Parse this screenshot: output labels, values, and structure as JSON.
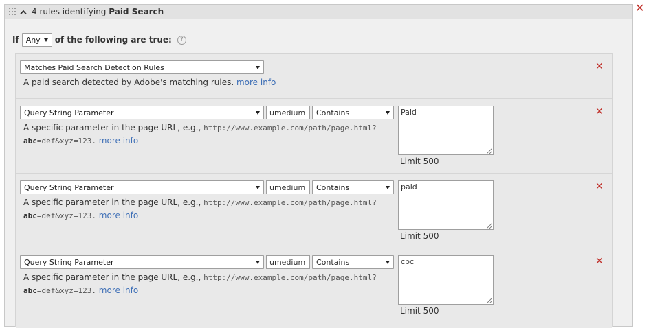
{
  "header": {
    "title_prefix": "4 rules identifying",
    "title_bold": "Paid Search"
  },
  "condition": {
    "if_label": "If",
    "match_value": "Any",
    "suffix": "of the following are true:",
    "help_glyph": "?"
  },
  "close_glyph": "✕",
  "rules": [
    {
      "type": "Matches Paid Search Detection Rules",
      "description": "A paid search detected by Adobe's matching rules.",
      "more_info": "more info"
    },
    {
      "type": "Query String Parameter",
      "param": "umedium",
      "operator": "Contains",
      "value": "Paid",
      "limit": "Limit 500",
      "desc_prefix": "A specific parameter in the page URL, e.g.,",
      "desc_url": "http://www.example.com/path/page.html?",
      "desc_param": "abc",
      "desc_rest": "=def&xyz=123.",
      "more_info": "more info"
    },
    {
      "type": "Query String Parameter",
      "param": "umedium",
      "operator": "Contains",
      "value": "paid",
      "limit": "Limit 500",
      "desc_prefix": "A specific parameter in the page URL, e.g.,",
      "desc_url": "http://www.example.com/path/page.html?",
      "desc_param": "abc",
      "desc_rest": "=def&xyz=123.",
      "more_info": "more info"
    },
    {
      "type": "Query String Parameter",
      "param": "umedium",
      "operator": "Contains",
      "value": "cpc",
      "limit": "Limit 500",
      "desc_prefix": "A specific parameter in the page URL, e.g.,",
      "desc_url": "http://www.example.com/path/page.html?",
      "desc_param": "abc",
      "desc_rest": "=def&xyz=123.",
      "more_info": "more info"
    }
  ],
  "colors": {
    "remove": "#c0302a",
    "link": "#3e6fb6"
  }
}
